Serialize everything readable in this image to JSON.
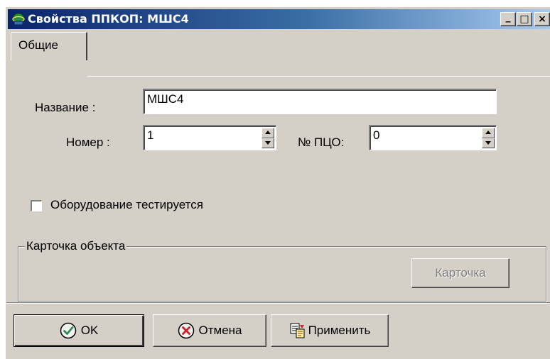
{
  "window": {
    "title": "Свойства ППКОП: МШС4",
    "buttons": {
      "minimize": "_",
      "maximize": "□",
      "close": "×"
    }
  },
  "tabs": [
    {
      "label": "Общие",
      "active": true
    }
  ],
  "form": {
    "name_label": "Название :",
    "name_value": "МШС4",
    "number_label": "Номер :",
    "number_value": "1",
    "pco_label": "№ ПЦО:",
    "pco_value": "0",
    "test_checkbox_label": "Оборудование тестируется",
    "test_checkbox_checked": false
  },
  "object_card": {
    "group_label": "Карточка объекта",
    "card_button_label": "Карточка",
    "card_button_enabled": false
  },
  "footer": {
    "ok_label": "OK",
    "cancel_label": "Отмена",
    "apply_label": "Применить"
  },
  "colors": {
    "window_bg": "#d4d0c8",
    "title_start": "#0a246a",
    "title_end": "#a6caf0",
    "ok_icon": "#2e8b57",
    "cancel_icon": "#d0202a"
  },
  "icons": {
    "app": "app-globe-icon",
    "ok": "check-circle-icon",
    "cancel": "x-circle-icon",
    "apply": "apply-document-icon"
  }
}
